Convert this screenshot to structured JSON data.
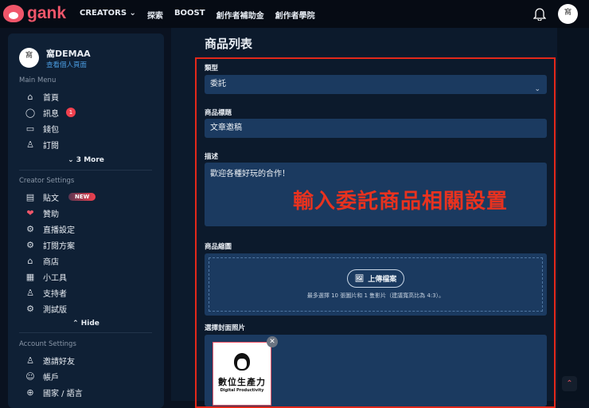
{
  "header": {
    "brand": "gank",
    "nav": [
      "CREATORS",
      "探索",
      "BOOST",
      "創作者補助金",
      "創作者學院"
    ],
    "avatar_text": "窩"
  },
  "profile": {
    "avatar_text": "窩",
    "name": "窩DEMAA",
    "link": "查看個人頁面"
  },
  "main_menu": {
    "title": "Main Menu",
    "items": [
      {
        "label": "首頁",
        "icon": "home-icon"
      },
      {
        "label": "訊息",
        "icon": "chat-icon",
        "badge": "1"
      },
      {
        "label": "錢包",
        "icon": "wallet-icon"
      },
      {
        "label": "訂閱",
        "icon": "user-icon"
      }
    ],
    "more": "3 More"
  },
  "creator_settings": {
    "title": "Creator Settings",
    "items": [
      {
        "label": "貼文",
        "badge": "NEW"
      },
      {
        "label": "贊助"
      },
      {
        "label": "直播設定"
      },
      {
        "label": "訂閱方案"
      },
      {
        "label": "商店"
      },
      {
        "label": "小工具"
      },
      {
        "label": "支持者"
      },
      {
        "label": "測試版"
      }
    ],
    "hide": "Hide"
  },
  "account_settings": {
    "title": "Account Settings",
    "items": [
      {
        "label": "邀請好友"
      },
      {
        "label": "帳戶"
      },
      {
        "label": "國家 / 語言"
      }
    ]
  },
  "form": {
    "page_title": "商品列表",
    "type_label": "類型",
    "type_value": "委託",
    "title_label": "商品標題",
    "title_value": "文章邀稿",
    "desc_label": "描述",
    "desc_value": "歡迎各種好玩的合作！",
    "annotation": "輸入委託商品相關設置",
    "thumb_label": "商品縮圖",
    "upload_button": "上傳檔案",
    "upload_hint": "最多選擇 10 張圖片和 1 隻影片（建議寬高比為 4:3）。",
    "cover_label": "選擇封面照片",
    "cover_title": "數位生產力",
    "cover_subtitle": "Digital Productivity"
  },
  "colors": {
    "accent": "#f0566a",
    "annotation": "#e3281a"
  }
}
